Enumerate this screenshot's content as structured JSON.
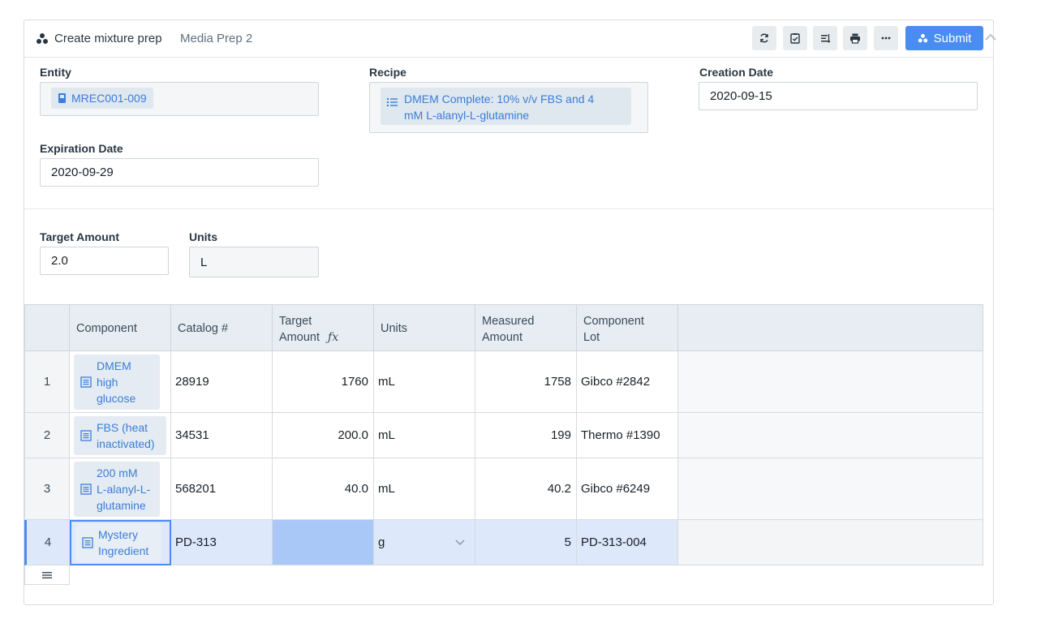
{
  "header": {
    "title": "Create mixture prep",
    "subtitle": "Media Prep 2",
    "submit_label": "Submit",
    "toolbar_icons": [
      "refresh-icon",
      "clipboard-check-icon",
      "sort-icon",
      "print-icon",
      "more-icon"
    ]
  },
  "form": {
    "entity_label": "Entity",
    "entity_value": "MREC001-009",
    "recipe_label": "Recipe",
    "recipe_value_line1": "DMEM Complete: 10% v/v FBS and 4",
    "recipe_value_line2": "mM L-alanyl-L-glutamine",
    "creation_date_label": "Creation Date",
    "creation_date_value": "2020-09-15",
    "expiration_date_label": "Expiration Date",
    "expiration_date_value": "2020-09-29",
    "target_amount_label": "Target Amount",
    "target_amount_value": "2.0",
    "units_label": "Units",
    "units_value": "L"
  },
  "table": {
    "columns": {
      "component": "Component",
      "catalog": "Catalog #",
      "target_amount_1": "Target",
      "target_amount_2": "Amount",
      "fx": "ƒx",
      "units": "Units",
      "measured_1": "Measured",
      "measured_2": "Amount",
      "lot_1": "Component",
      "lot_2": "Lot"
    },
    "rows": [
      {
        "index": "1",
        "component": [
          "DMEM",
          "high",
          "glucose"
        ],
        "catalog": "28919",
        "target": "1760",
        "units": "mL",
        "measured": "1758",
        "lot": "Gibco #2842"
      },
      {
        "index": "2",
        "component": [
          "FBS (heat",
          "inactivated)"
        ],
        "catalog": "34531",
        "target": "200.0",
        "units": "mL",
        "measured": "199",
        "lot": "Thermo #1390"
      },
      {
        "index": "3",
        "component": [
          "200 mM",
          "L-alanyl-L-",
          "glutamine"
        ],
        "catalog": "568201",
        "target": "40.0",
        "units": "mL",
        "measured": "40.2",
        "lot": "Gibco #6249"
      },
      {
        "index": "4",
        "component": [
          "Mystery",
          "Ingredient"
        ],
        "catalog": "PD-313",
        "target": "",
        "units": "g",
        "measured": "5",
        "lot": "PD-313-004"
      }
    ],
    "footer_icon": "menu-icon"
  },
  "colors": {
    "accent": "#4a8df0",
    "chip_text": "#3b7dd8",
    "header_bg": "#e7edf2",
    "selected_row": "#dde8fb",
    "active_cell": "#a9c7f7"
  }
}
